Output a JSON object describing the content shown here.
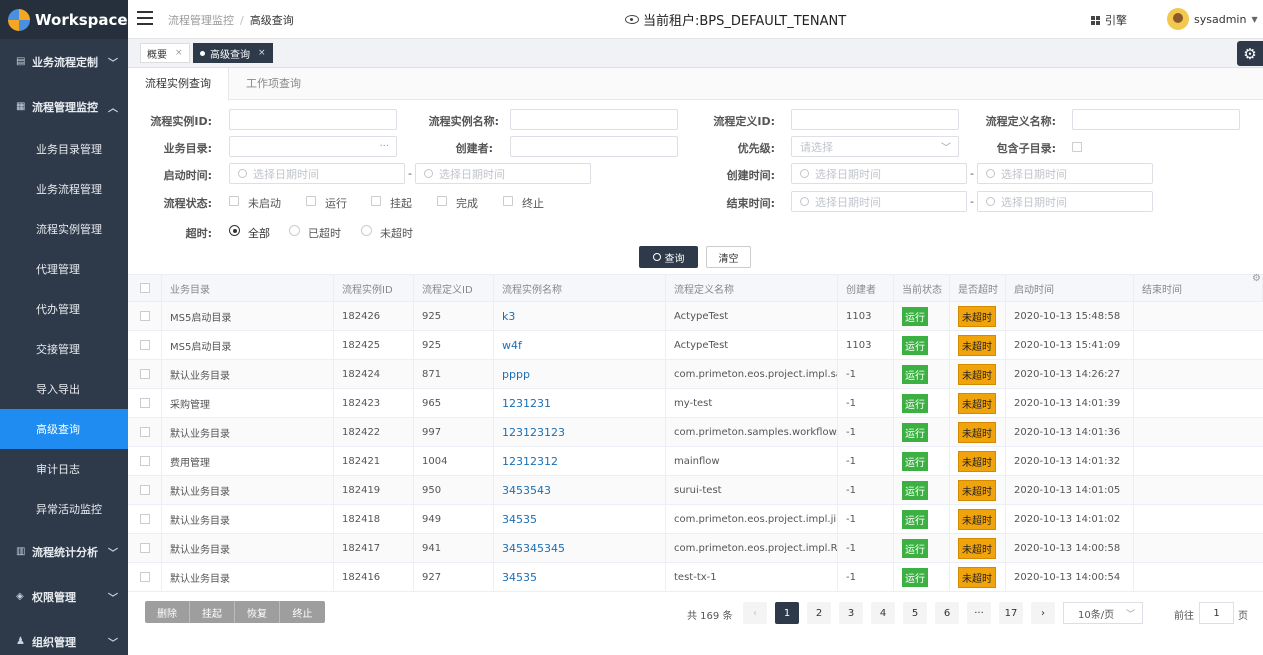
{
  "app": {
    "logo_text": "Workspace"
  },
  "sidebar": {
    "groups": [
      {
        "label": "业务流程定制",
        "icon": "layout-icon",
        "chev": "﹀"
      },
      {
        "label": "流程管理监控",
        "icon": "grid-icon",
        "chev": "︿"
      },
      {
        "label": "流程统计分析",
        "icon": "bar-chart-icon",
        "chev": "﹀"
      },
      {
        "label": "权限管理",
        "icon": "shield-icon",
        "chev": "﹀"
      },
      {
        "label": "组织管理",
        "icon": "user-icon",
        "chev": "﹀"
      }
    ],
    "items": [
      {
        "label": "业务目录管理"
      },
      {
        "label": "业务流程管理"
      },
      {
        "label": "流程实例管理"
      },
      {
        "label": "代理管理"
      },
      {
        "label": "代办管理"
      },
      {
        "label": "交接管理"
      },
      {
        "label": "导入导出"
      },
      {
        "label": "高级查询",
        "active": true
      },
      {
        "label": "审计日志"
      },
      {
        "label": "异常活动监控"
      }
    ]
  },
  "topbar": {
    "breadcrumb_parent": "流程管理监控",
    "breadcrumb_sep": "/",
    "breadcrumb_current": "高级查询",
    "tenant": "当前租户:BPS_DEFAULT_TENANT",
    "guide": "引擎",
    "username": "sysadmin"
  },
  "pagetabs": [
    {
      "label": "概要",
      "close": "×"
    },
    {
      "label": "高级查询",
      "close": "×",
      "active": true
    }
  ],
  "subtabs": [
    {
      "label": "流程实例查询",
      "active": true
    },
    {
      "label": "工作项查询"
    }
  ],
  "form": {
    "process_instance_id": "流程实例ID:",
    "process_instance_name": "流程实例名称:",
    "process_definition_id": "流程定义ID:",
    "process_definition_name": "流程定义名称:",
    "business_catalog": "业务目录:",
    "business_catalog_suffix": "···",
    "creator": "创建者:",
    "priority": "优先级:",
    "priority_placeholder": "请选择",
    "priority_chev": "﹀",
    "include_sub": "包含子目录:",
    "start_time": "启动时间:",
    "create_time": "创建时间:",
    "end_time": "结束时间:",
    "date_placeholder": "选择日期时间",
    "dash": "-",
    "status": "流程状态:",
    "status_options": [
      "未启动",
      "运行",
      "挂起",
      "完成",
      "终止"
    ],
    "timeout": "超时:",
    "timeout_options": [
      "全部",
      "已超时",
      "未超时"
    ],
    "query_button": "查询",
    "clear_button": "清空"
  },
  "table": {
    "headers": [
      "业务目录",
      "流程实例ID",
      "流程定义ID",
      "流程实例名称",
      "流程定义名称",
      "创建者",
      "当前状态",
      "是否超时",
      "启动时间",
      "结束时间"
    ],
    "gear": "⚙",
    "rows": [
      [
        "MS5启动目录",
        "182426",
        "925",
        "k3",
        "ActypeTest",
        "1103",
        "运行",
        "未超时",
        "2020-10-13 15:48:58",
        ""
      ],
      [
        "MS5启动目录",
        "182425",
        "925",
        "w4f",
        "ActypeTest",
        "1103",
        "运行",
        "未超时",
        "2020-10-13 15:41:09",
        ""
      ],
      [
        "默认业务目录",
        "182424",
        "871",
        "pppp",
        "com.primeton.eos.project.impl.sa...",
        "-1",
        "运行",
        "未超时",
        "2020-10-13 14:26:27",
        ""
      ],
      [
        "采购管理",
        "182423",
        "965",
        "1231231",
        "my-test",
        "-1",
        "运行",
        "未超时",
        "2020-10-13 14:01:39",
        ""
      ],
      [
        "默认业务目录",
        "182422",
        "997",
        "123123123",
        "com.primeton.samples.workflow.a...",
        "-1",
        "运行",
        "未超时",
        "2020-10-13 14:01:36",
        ""
      ],
      [
        "费用管理",
        "182421",
        "1004",
        "12312312",
        "mainflow",
        "-1",
        "运行",
        "未超时",
        "2020-10-13 14:01:32",
        ""
      ],
      [
        "默认业务目录",
        "182419",
        "950",
        "3453543",
        "surui-test",
        "-1",
        "运行",
        "未超时",
        "2020-10-13 14:01:05",
        ""
      ],
      [
        "默认业务目录",
        "182418",
        "949",
        "34535",
        "com.primeton.eos.project.impl.jib...",
        "-1",
        "运行",
        "未超时",
        "2020-10-13 14:01:02",
        ""
      ],
      [
        "默认业务目录",
        "182417",
        "941",
        "345345345",
        "com.primeton.eos.project.impl.RGG",
        "-1",
        "运行",
        "未超时",
        "2020-10-13 14:00:58",
        ""
      ],
      [
        "默认业务目录",
        "182416",
        "927",
        "34535",
        "test-tx-1",
        "-1",
        "运行",
        "未超时",
        "2020-10-13 14:00:54",
        ""
      ]
    ]
  },
  "footer": {
    "bulk_actions": [
      "删除",
      "挂起",
      "恢复",
      "终止"
    ],
    "total": "共 169 条",
    "prev": "‹",
    "next": "›",
    "pages": [
      "1",
      "2",
      "3",
      "4",
      "5",
      "6",
      "···",
      "17"
    ],
    "page_size": "10条/页",
    "page_size_chev": "﹀",
    "goto_label": "前往",
    "goto_value": "1",
    "goto_unit": "页"
  }
}
